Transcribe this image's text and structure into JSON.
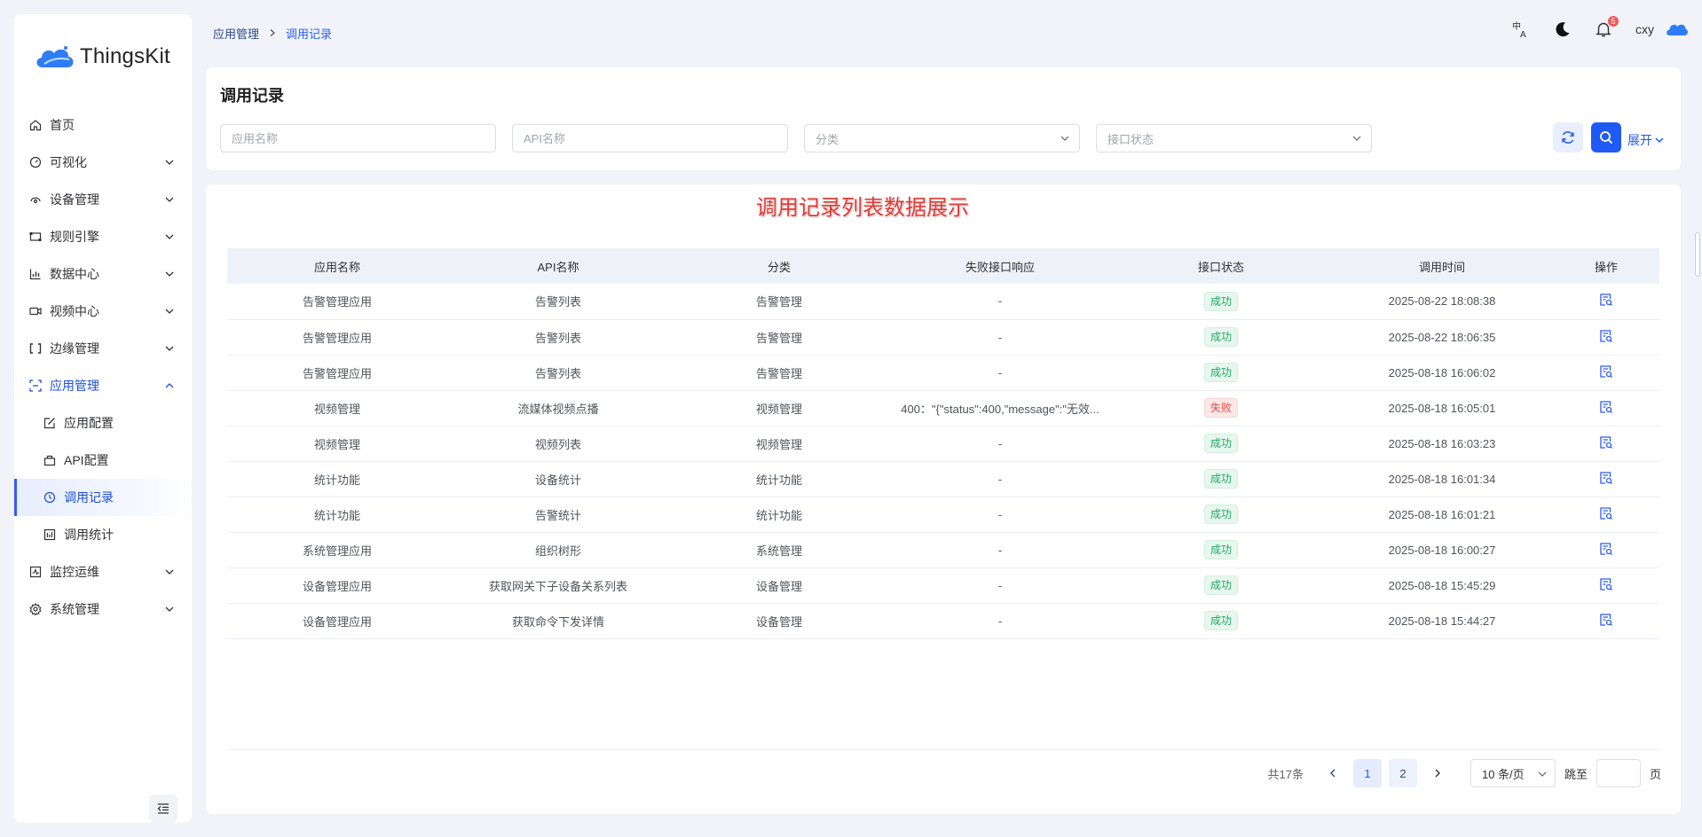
{
  "app": {
    "logo_text": "ThingsKit"
  },
  "breadcrumb": {
    "parent": "应用管理",
    "current": "调用记录"
  },
  "topbar": {
    "username": "cxy",
    "notification_count": "5"
  },
  "sidebar": {
    "items": [
      {
        "label": "首页"
      },
      {
        "label": "可视化"
      },
      {
        "label": "设备管理"
      },
      {
        "label": "规则引擎"
      },
      {
        "label": "数据中心"
      },
      {
        "label": "视频中心"
      },
      {
        "label": "边缘管理"
      },
      {
        "label": "应用管理"
      },
      {
        "label": "监控运维"
      },
      {
        "label": "系统管理"
      }
    ],
    "sub_items": [
      {
        "label": "应用配置"
      },
      {
        "label": "API配置"
      },
      {
        "label": "调用记录"
      },
      {
        "label": "调用统计"
      }
    ]
  },
  "search": {
    "title": "调用记录",
    "app_name_placeholder": "应用名称",
    "api_name_placeholder": "API名称",
    "category_placeholder": "分类",
    "status_placeholder": "接口状态",
    "expand_label": "展开"
  },
  "annotation": "调用记录列表数据展示",
  "table": {
    "headers": [
      "应用名称",
      "API名称",
      "分类",
      "失败接口响应",
      "接口状态",
      "调用时间",
      "操作"
    ],
    "rows": [
      {
        "app": "告警管理应用",
        "api": "告警列表",
        "category": "告警管理",
        "fail_resp": "-",
        "status": "成功",
        "time": "2025-08-22 18:08:38"
      },
      {
        "app": "告警管理应用",
        "api": "告警列表",
        "category": "告警管理",
        "fail_resp": "-",
        "status": "成功",
        "time": "2025-08-22 18:06:35"
      },
      {
        "app": "告警管理应用",
        "api": "告警列表",
        "category": "告警管理",
        "fail_resp": "-",
        "status": "成功",
        "time": "2025-08-18 16:06:02"
      },
      {
        "app": "视频管理",
        "api": "流媒体视频点播",
        "category": "视频管理",
        "fail_resp": "400：\"{\"status\":400,\"message\":\"无效...",
        "status": "失败",
        "time": "2025-08-18 16:05:01"
      },
      {
        "app": "视频管理",
        "api": "视频列表",
        "category": "视频管理",
        "fail_resp": "-",
        "status": "成功",
        "time": "2025-08-18 16:03:23"
      },
      {
        "app": "统计功能",
        "api": "设备统计",
        "category": "统计功能",
        "fail_resp": "-",
        "status": "成功",
        "time": "2025-08-18 16:01:34"
      },
      {
        "app": "统计功能",
        "api": "告警统计",
        "category": "统计功能",
        "fail_resp": "-",
        "status": "成功",
        "time": "2025-08-18 16:01:21"
      },
      {
        "app": "系统管理应用",
        "api": "组织树形",
        "category": "系统管理",
        "fail_resp": "-",
        "status": "成功",
        "time": "2025-08-18 16:00:27"
      },
      {
        "app": "设备管理应用",
        "api": "获取网关下子设备关系列表",
        "category": "设备管理",
        "fail_resp": "-",
        "status": "成功",
        "time": "2025-08-18 15:45:29"
      },
      {
        "app": "设备管理应用",
        "api": "获取命令下发详情",
        "category": "设备管理",
        "fail_resp": "-",
        "status": "成功",
        "time": "2025-08-18 15:44:27"
      }
    ]
  },
  "pagination": {
    "total": "共17条",
    "pages": [
      "1",
      "2"
    ],
    "current_page": "1",
    "page_size": "10 条/页",
    "jump_label": "跳至",
    "page_suffix": "页"
  },
  "colors": {
    "primary": "#1f5af5",
    "success": "#22a867",
    "fail": "#f04646",
    "background": "#f1f3f8"
  }
}
